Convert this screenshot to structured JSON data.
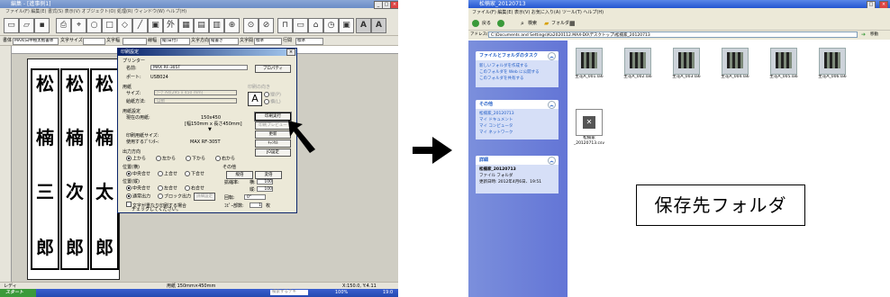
{
  "left_window": {
    "title": "編集 - [進事例1]",
    "menu": "ファイル(F)  編集(E)  書式(S)  表示(V)  オブジェクト(O)  処理(R)  ウィンドウ(W)  ヘルプ(H)",
    "format_bar": {
      "font_label": "書体",
      "font_value": "MAX(日中極太楷書体",
      "size_label": "文字サイズ",
      "size_value": "",
      "combo_1_label": "文字幅",
      "combo_1_value": "",
      "combo_2_label": "線幅",
      "combo_2_value": "縦(日付)",
      "combo_3_label": "文字方向",
      "combo_3_value": "縦書き",
      "combo_4_label": "文字間",
      "combo_4_value": "標準",
      "combo_5_label": "行間",
      "combo_5_value": "標準"
    },
    "labels": [
      {
        "col1": "松",
        "col2": "松",
        "col3": "松"
      },
      {
        "col1": "楠",
        "col2": "楠",
        "col3": "楠"
      },
      {
        "col1": "三",
        "col2": "次",
        "col3": "太"
      },
      {
        "col1": "郎",
        "col2": "郎",
        "col3": "郎"
      }
    ],
    "status_left": "レディ",
    "status_mid": "用紙 150mm×450mm",
    "status_right": "X:150.0, Y:4.11",
    "taskbar": {
      "start": "スタート",
      "search": "検索するテキ",
      "zoom": "100%",
      "clock": "19:0"
    },
    "dialog": {
      "title": "印刷設定",
      "close": "×",
      "printer_group": "プリンター",
      "name_label": "名前:",
      "printer_name": "MAX RF-305T",
      "properties_button": "プロパティ",
      "port_label": "ポート:",
      "port_value": "USB024",
      "paper_group": "用紙",
      "size_label": "サイズ:",
      "size_value": "ﾃｰﾌﾟA4(295 x 450 mm)",
      "feed_label": "給紙方法:",
      "feed_value": "自動",
      "orientation_group": "印刷の向き",
      "orientation_portrait": "縦(P)",
      "orientation_landscape": "横(L)",
      "paper_settings_group": "用紙設定",
      "current_paper_label": "現在の用紙:",
      "current_paper_value": "150x450",
      "current_paper_detail": "[幅150mm x 長さ450mm]",
      "print_size_label": "印刷用紙サイズ:",
      "printer_used_label": "使用するﾌﾟﾘﾝﾀｰ:",
      "printer_used_value": "MAX RF-305T",
      "print_button": "印刷実行",
      "preview_button": "印刷プレビュー",
      "update_button": "更新",
      "cancel_button": "ｷｬﾝｾﾙ",
      "jo_button": "JO設定",
      "output_dir_group": "出力方向",
      "dir_top": "上から",
      "dir_left": "左から",
      "dir_bottom": "下から",
      "dir_right": "右から",
      "pos_x_group": "位置(横)",
      "pos_center": "中央合せ",
      "pos_top": "上合せ",
      "pos_bottom": "下合せ",
      "pos_y_group": "位置(縦)",
      "pos_y_center": "中央合せ",
      "pos_y_left": "左合せ",
      "pos_y_right": "右合せ",
      "output_mode_normal": "通常出力",
      "output_mode_block": "ブロック出力",
      "output_mode_btn": "詳細設定",
      "other_group": "その他",
      "mirror_button": "縦倍",
      "flip_button": "変倍",
      "scale_label": "拡縮率:",
      "scale_w_label": "横:",
      "scale_w": "100",
      "scale_h_label": "縦:",
      "scale_h": "100",
      "rotate_label": "回転:",
      "rotate_value": "0°",
      "copies_label": "ｺﾋﾟｰ部数:",
      "copies_value": "1",
      "copies_unit": "枚",
      "check_note_1": "文字が重なり印刷する場合",
      "check_note_2": "チェックしてください。"
    }
  },
  "right_window": {
    "title": "松楠家_20120713",
    "menu": "ファイル(F)  編集(E)  表示(V)  お気に入り(A)  ツール(T)  ヘルプ(H)",
    "nav": {
      "back": "戻る",
      "search": "検索",
      "folders": "フォルダ"
    },
    "address_label": "アドレス(D)",
    "address_value": "C:\\Documents and Settings\\Ka2020112.MAX-D0\\デスクトップ\\松楠家_20120713",
    "go_label": "移動",
    "tasks_panel": {
      "title": "ファイルとフォルダのタスク",
      "items": [
        "新しいフォルダを作成する",
        "このフォルダを Web に公開する",
        "このフォルダを共有する"
      ]
    },
    "other_panel": {
      "title": "その他",
      "items": [
        "松楠家_20120713",
        "マイ ドキュメント",
        "マイ コンピュータ",
        "マイ ネットワーク"
      ]
    },
    "detail_panel": {
      "title": "詳細",
      "name": "松楠家_20120713",
      "type": "ファイル フォルダ",
      "date": "更新日時: 2012年4月6日、19:51"
    },
    "files": [
      {
        "name": "生花A_001.la6"
      },
      {
        "name": "生花A_002.la6"
      },
      {
        "name": "生花A_003.la6"
      },
      {
        "name": "生花A_004.la6"
      },
      {
        "name": "生花A_005.la6"
      },
      {
        "name": "生花A_006.la6"
      },
      {
        "name": "松楠家_20120713.csv"
      }
    ],
    "callout": "保存先フォルダ"
  }
}
